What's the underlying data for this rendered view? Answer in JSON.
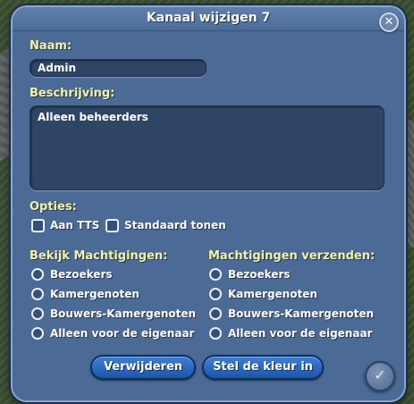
{
  "dialog": {
    "title": "Kanaal wijzigen 7",
    "close_icon": "close-icon"
  },
  "name": {
    "label": "Naam:",
    "value": "Admin"
  },
  "description": {
    "label": "Beschrijving:",
    "value": "Alleen beheerders"
  },
  "options": {
    "label": "Opties:",
    "items": [
      {
        "label": "Aan TTS",
        "checked": false
      },
      {
        "label": "Standaard tonen",
        "checked": false
      }
    ]
  },
  "view_permissions": {
    "label": "Bekijk Machtigingen:",
    "items": [
      "Bezoekers",
      "Kamergenoten",
      "Bouwers-Kamergenoten",
      "Alleen voor de eigenaar"
    ]
  },
  "send_permissions": {
    "label": "Machtigingen verzenden:",
    "items": [
      "Bezoekers",
      "Kamergenoten",
      "Bouwers-Kamergenoten",
      "Alleen voor de eigenaar"
    ]
  },
  "buttons": {
    "delete": "Verwijderen",
    "set_color": "Stel de kleur in",
    "ok_icon": "checkmark-icon"
  },
  "colors": {
    "dialog_bg": "#4b6b96",
    "label_yellow": "#f4f1a8",
    "button_blue": "#2b6bc2"
  }
}
